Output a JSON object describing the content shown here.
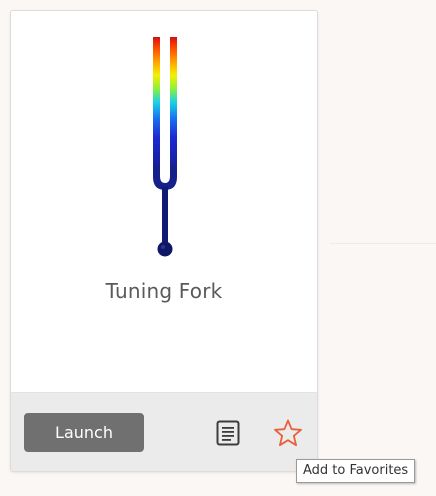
{
  "card": {
    "title": "Tuning Fork",
    "thumbnail_icon": "tuning-fork-rainbow-icon",
    "launch_label": "Launch",
    "doc_icon": "document-icon",
    "favorite_icon": "star-outline-icon"
  },
  "tooltip": {
    "text": "Add to Favorites"
  },
  "colors": {
    "launch_button": "#707070",
    "footer": "#ebebeb",
    "star": "#e8613a",
    "title_text": "#5a5a5a"
  }
}
